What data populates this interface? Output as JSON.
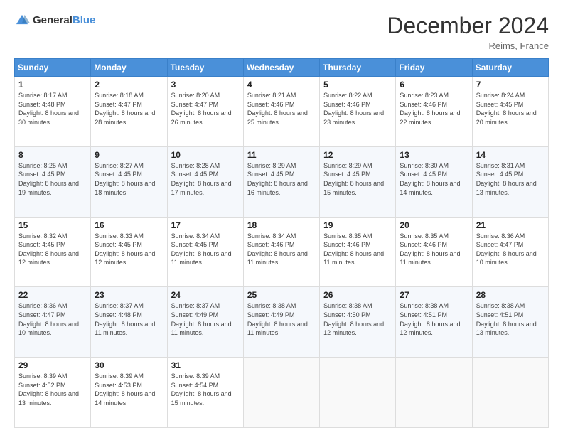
{
  "header": {
    "logo_general": "General",
    "logo_blue": "Blue",
    "title": "December 2024",
    "subtitle": "Reims, France"
  },
  "days_of_week": [
    "Sunday",
    "Monday",
    "Tuesday",
    "Wednesday",
    "Thursday",
    "Friday",
    "Saturday"
  ],
  "weeks": [
    [
      {
        "day": "1",
        "sunrise": "Sunrise: 8:17 AM",
        "sunset": "Sunset: 4:48 PM",
        "daylight": "Daylight: 8 hours and 30 minutes."
      },
      {
        "day": "2",
        "sunrise": "Sunrise: 8:18 AM",
        "sunset": "Sunset: 4:47 PM",
        "daylight": "Daylight: 8 hours and 28 minutes."
      },
      {
        "day": "3",
        "sunrise": "Sunrise: 8:20 AM",
        "sunset": "Sunset: 4:47 PM",
        "daylight": "Daylight: 8 hours and 26 minutes."
      },
      {
        "day": "4",
        "sunrise": "Sunrise: 8:21 AM",
        "sunset": "Sunset: 4:46 PM",
        "daylight": "Daylight: 8 hours and 25 minutes."
      },
      {
        "day": "5",
        "sunrise": "Sunrise: 8:22 AM",
        "sunset": "Sunset: 4:46 PM",
        "daylight": "Daylight: 8 hours and 23 minutes."
      },
      {
        "day": "6",
        "sunrise": "Sunrise: 8:23 AM",
        "sunset": "Sunset: 4:46 PM",
        "daylight": "Daylight: 8 hours and 22 minutes."
      },
      {
        "day": "7",
        "sunrise": "Sunrise: 8:24 AM",
        "sunset": "Sunset: 4:45 PM",
        "daylight": "Daylight: 8 hours and 20 minutes."
      }
    ],
    [
      {
        "day": "8",
        "sunrise": "Sunrise: 8:25 AM",
        "sunset": "Sunset: 4:45 PM",
        "daylight": "Daylight: 8 hours and 19 minutes."
      },
      {
        "day": "9",
        "sunrise": "Sunrise: 8:27 AM",
        "sunset": "Sunset: 4:45 PM",
        "daylight": "Daylight: 8 hours and 18 minutes."
      },
      {
        "day": "10",
        "sunrise": "Sunrise: 8:28 AM",
        "sunset": "Sunset: 4:45 PM",
        "daylight": "Daylight: 8 hours and 17 minutes."
      },
      {
        "day": "11",
        "sunrise": "Sunrise: 8:29 AM",
        "sunset": "Sunset: 4:45 PM",
        "daylight": "Daylight: 8 hours and 16 minutes."
      },
      {
        "day": "12",
        "sunrise": "Sunrise: 8:29 AM",
        "sunset": "Sunset: 4:45 PM",
        "daylight": "Daylight: 8 hours and 15 minutes."
      },
      {
        "day": "13",
        "sunrise": "Sunrise: 8:30 AM",
        "sunset": "Sunset: 4:45 PM",
        "daylight": "Daylight: 8 hours and 14 minutes."
      },
      {
        "day": "14",
        "sunrise": "Sunrise: 8:31 AM",
        "sunset": "Sunset: 4:45 PM",
        "daylight": "Daylight: 8 hours and 13 minutes."
      }
    ],
    [
      {
        "day": "15",
        "sunrise": "Sunrise: 8:32 AM",
        "sunset": "Sunset: 4:45 PM",
        "daylight": "Daylight: 8 hours and 12 minutes."
      },
      {
        "day": "16",
        "sunrise": "Sunrise: 8:33 AM",
        "sunset": "Sunset: 4:45 PM",
        "daylight": "Daylight: 8 hours and 12 minutes."
      },
      {
        "day": "17",
        "sunrise": "Sunrise: 8:34 AM",
        "sunset": "Sunset: 4:45 PM",
        "daylight": "Daylight: 8 hours and 11 minutes."
      },
      {
        "day": "18",
        "sunrise": "Sunrise: 8:34 AM",
        "sunset": "Sunset: 4:46 PM",
        "daylight": "Daylight: 8 hours and 11 minutes."
      },
      {
        "day": "19",
        "sunrise": "Sunrise: 8:35 AM",
        "sunset": "Sunset: 4:46 PM",
        "daylight": "Daylight: 8 hours and 11 minutes."
      },
      {
        "day": "20",
        "sunrise": "Sunrise: 8:35 AM",
        "sunset": "Sunset: 4:46 PM",
        "daylight": "Daylight: 8 hours and 11 minutes."
      },
      {
        "day": "21",
        "sunrise": "Sunrise: 8:36 AM",
        "sunset": "Sunset: 4:47 PM",
        "daylight": "Daylight: 8 hours and 10 minutes."
      }
    ],
    [
      {
        "day": "22",
        "sunrise": "Sunrise: 8:36 AM",
        "sunset": "Sunset: 4:47 PM",
        "daylight": "Daylight: 8 hours and 10 minutes."
      },
      {
        "day": "23",
        "sunrise": "Sunrise: 8:37 AM",
        "sunset": "Sunset: 4:48 PM",
        "daylight": "Daylight: 8 hours and 11 minutes."
      },
      {
        "day": "24",
        "sunrise": "Sunrise: 8:37 AM",
        "sunset": "Sunset: 4:49 PM",
        "daylight": "Daylight: 8 hours and 11 minutes."
      },
      {
        "day": "25",
        "sunrise": "Sunrise: 8:38 AM",
        "sunset": "Sunset: 4:49 PM",
        "daylight": "Daylight: 8 hours and 11 minutes."
      },
      {
        "day": "26",
        "sunrise": "Sunrise: 8:38 AM",
        "sunset": "Sunset: 4:50 PM",
        "daylight": "Daylight: 8 hours and 12 minutes."
      },
      {
        "day": "27",
        "sunrise": "Sunrise: 8:38 AM",
        "sunset": "Sunset: 4:51 PM",
        "daylight": "Daylight: 8 hours and 12 minutes."
      },
      {
        "day": "28",
        "sunrise": "Sunrise: 8:38 AM",
        "sunset": "Sunset: 4:51 PM",
        "daylight": "Daylight: 8 hours and 13 minutes."
      }
    ],
    [
      {
        "day": "29",
        "sunrise": "Sunrise: 8:39 AM",
        "sunset": "Sunset: 4:52 PM",
        "daylight": "Daylight: 8 hours and 13 minutes."
      },
      {
        "day": "30",
        "sunrise": "Sunrise: 8:39 AM",
        "sunset": "Sunset: 4:53 PM",
        "daylight": "Daylight: 8 hours and 14 minutes."
      },
      {
        "day": "31",
        "sunrise": "Sunrise: 8:39 AM",
        "sunset": "Sunset: 4:54 PM",
        "daylight": "Daylight: 8 hours and 15 minutes."
      },
      null,
      null,
      null,
      null
    ]
  ]
}
